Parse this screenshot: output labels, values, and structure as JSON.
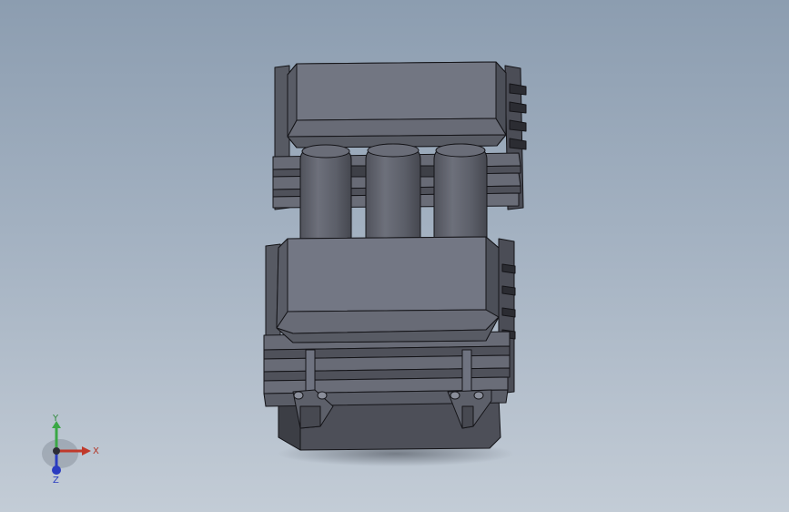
{
  "viewport": {
    "background_top": "#8c9db0",
    "background_bottom": "#c3ccd6"
  },
  "model": {
    "name": "",
    "body_color": "#62656f",
    "body_light": "#757985",
    "body_dark": "#4a4c55",
    "edge_color": "#141418",
    "cylinder_count": 3
  },
  "triad": {
    "x_label": "X",
    "y_label": "Y",
    "z_label": "Z",
    "x_color": "#c0392b",
    "y_color": "#3aa845",
    "z_color": "#2a3cc0"
  }
}
